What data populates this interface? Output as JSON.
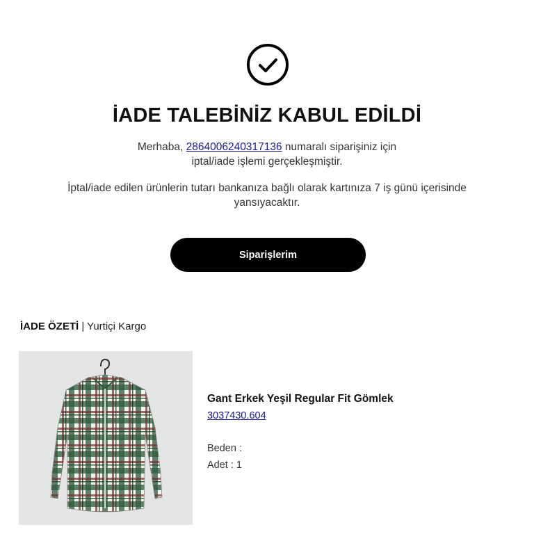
{
  "status_title": "İADE TALEBİNİZ KABUL EDİLDİ",
  "message": {
    "greeting_prefix": "Merhaba,",
    "order_number": "2864006240317136",
    "greeting_suffix": "numaralı siparişiniz için",
    "line2": "iptal/iade işlemi gerçekleşmiştir.",
    "refund_info": "İptal/iade edilen ürünlerin tutarı bankanıza bağlı olarak kartınıza 7 iş günü içerisinde yansıyacaktır."
  },
  "orders_button_label": "Siparişlerim",
  "return_summary": {
    "label": "İADE ÖZETİ",
    "separator": "|",
    "carrier": "Yurtiçi Kargo"
  },
  "product": {
    "name": "Gant Erkek Yeşil Regular Fit Gömlek",
    "code": "3037430.604",
    "size_label": "Beden :",
    "size_value": "",
    "quantity_label": "Adet :",
    "quantity_value": "1"
  },
  "icons": {
    "status": "check-circle-icon"
  }
}
